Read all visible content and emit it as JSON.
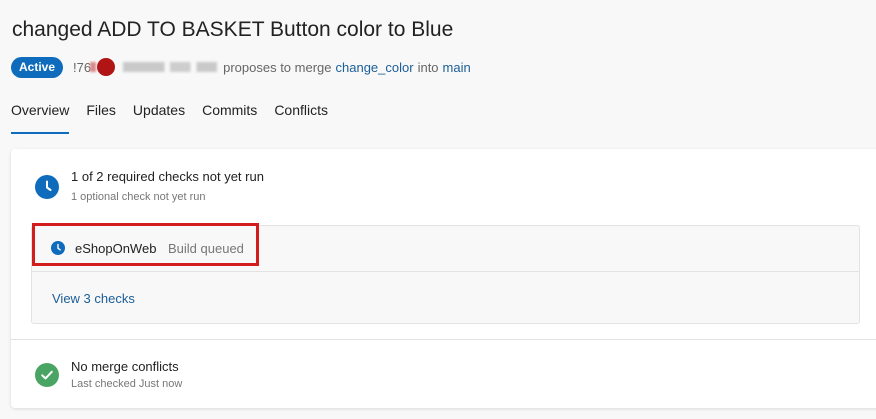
{
  "pr": {
    "title": "changed ADD TO BASKET Button color to Blue",
    "status_badge": "Active",
    "id": "!76",
    "proposes_text": "proposes to merge",
    "source_branch": "change_color",
    "into_text": "into",
    "target_branch": "main"
  },
  "tabs": [
    {
      "label": "Overview",
      "active": true
    },
    {
      "label": "Files",
      "active": false
    },
    {
      "label": "Updates",
      "active": false
    },
    {
      "label": "Commits",
      "active": false
    },
    {
      "label": "Conflicts",
      "active": false
    }
  ],
  "checks": {
    "summary_title": "1 of 2 required checks not yet run",
    "summary_subtitle": "1 optional check not yet run",
    "pipeline": {
      "name": "eShopOnWeb",
      "status": "Build queued"
    },
    "view_link": "View 3 checks"
  },
  "merge": {
    "title": "No merge conflicts",
    "subtitle": "Last checked Just now"
  },
  "icons": {
    "pending": "clock-icon",
    "success": "checkmark-icon"
  },
  "colors": {
    "accent": "#0f6cbd",
    "link": "#1b5e98",
    "success": "#4aa564",
    "highlight": "#d31c1c"
  }
}
